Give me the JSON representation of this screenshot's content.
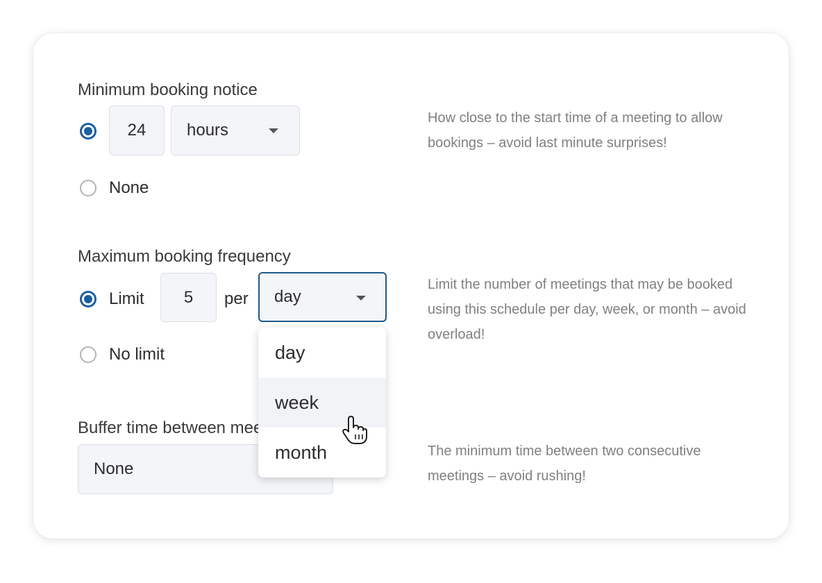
{
  "min_notice": {
    "title": "Minimum booking notice",
    "amount_value": "24",
    "unit_value": "hours",
    "none_label": "None",
    "help": "How close to the start time of a meeting to allow bookings – avoid last minute surprises!",
    "selected": "amount"
  },
  "max_frequency": {
    "title": "Maximum booking frequency",
    "limit_label": "Limit",
    "limit_value": "5",
    "per_label": "per",
    "period_value": "day",
    "no_limit_label": "No limit",
    "help": "Limit the number of meetings that may be booked using this schedule per day, week, or month – avoid overload!",
    "selected": "limit",
    "dropdown": {
      "options": [
        "day",
        "week",
        "month"
      ],
      "hovered": "week"
    }
  },
  "buffer": {
    "title": "Buffer time between meetings",
    "value": "None",
    "help": "The minimum time between two consecutive meetings – avoid rushing!"
  },
  "colors": {
    "accent": "#1a5f9e",
    "field_bg": "#f3f5f8",
    "help_text": "#808080"
  }
}
